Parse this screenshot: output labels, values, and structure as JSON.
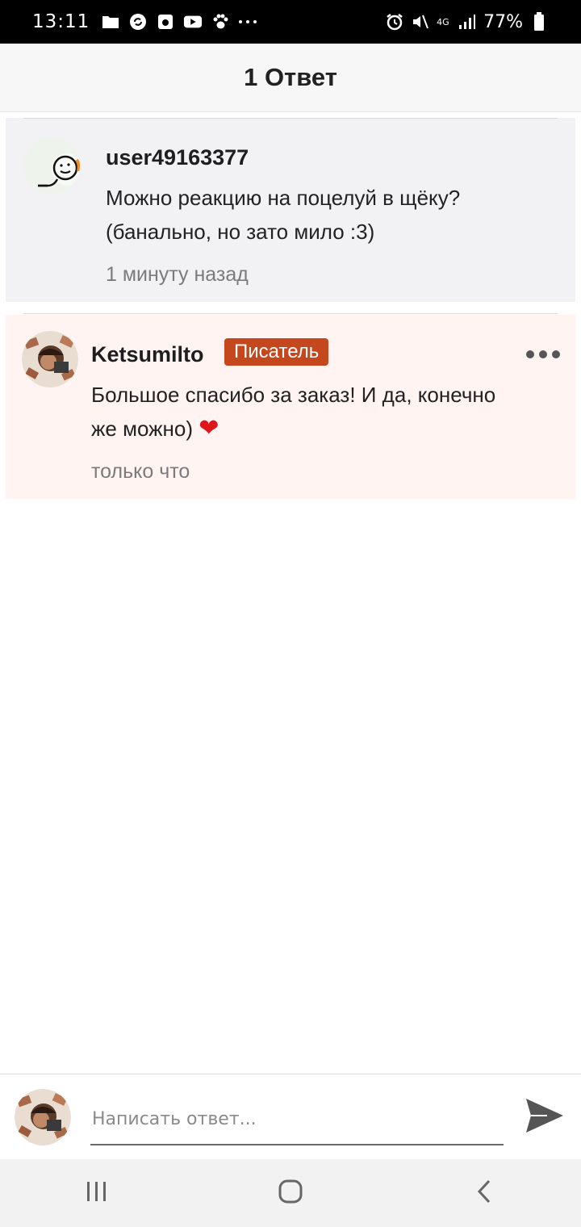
{
  "status_bar": {
    "time": "13:11",
    "network": "4G",
    "battery": "77%"
  },
  "header": {
    "title": "1 Ответ"
  },
  "original_comment": {
    "author": "user49163377",
    "text_line1": "Можно реакцию на поцелуй в щёку?",
    "text_line2": "(банально, но зато мило :3)",
    "time": "1 минуту назад"
  },
  "reply_comment": {
    "author": "Ketsumilto",
    "badge": "Писатель",
    "text_line1": "Большое спасибо за заказ! И да, конечно",
    "text_line2": "же можно)",
    "emoji": "❤",
    "time": "только что"
  },
  "reply_bar": {
    "placeholder": "Написать ответ..."
  },
  "colors": {
    "accent": "#c4471d",
    "reply_bg": "#fff4f1",
    "original_bg": "#f2f2f4"
  },
  "icons": {
    "send": "send-icon",
    "more": "more-dots-icon",
    "recents": "recents-icon",
    "home": "home-icon",
    "back": "back-icon"
  }
}
